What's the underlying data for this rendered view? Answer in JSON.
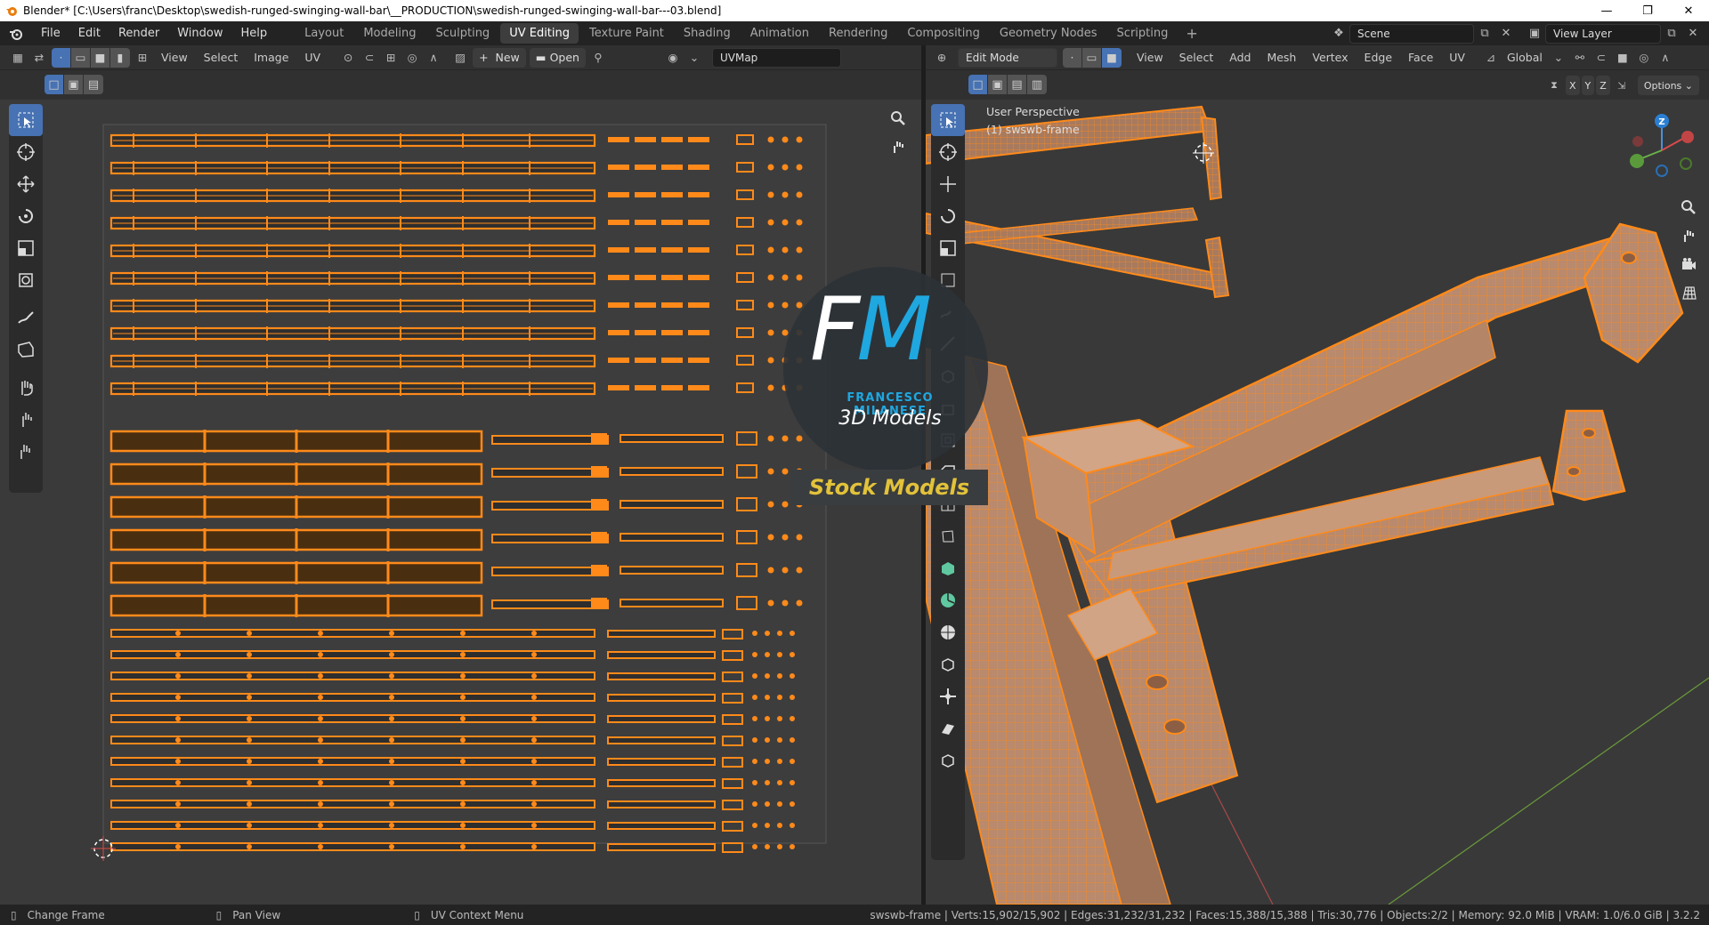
{
  "window": {
    "title": "Blender* [C:\\Users\\franc\\Desktop\\swedish-runged-swinging-wall-bar\\__PRODUCTION\\swedish-runged-swinging-wall-bar---03.blend]",
    "minimize": "—",
    "maximize": "❐",
    "close": "✕"
  },
  "menu": [
    "File",
    "Edit",
    "Render",
    "Window",
    "Help"
  ],
  "workspaces": [
    {
      "label": "Layout",
      "active": false
    },
    {
      "label": "Modeling",
      "active": false
    },
    {
      "label": "Sculpting",
      "active": false
    },
    {
      "label": "UV Editing",
      "active": true
    },
    {
      "label": "Texture Paint",
      "active": false
    },
    {
      "label": "Shading",
      "active": false
    },
    {
      "label": "Animation",
      "active": false
    },
    {
      "label": "Rendering",
      "active": false
    },
    {
      "label": "Compositing",
      "active": false
    },
    {
      "label": "Geometry Nodes",
      "active": false
    },
    {
      "label": "Scripting",
      "active": false
    }
  ],
  "add_workspace": "+",
  "scene": {
    "label": "Scene"
  },
  "view_layer": {
    "label": "View Layer"
  },
  "uv_header": {
    "menus": [
      "View",
      "Select",
      "Image",
      "UV"
    ],
    "new_label": "New",
    "open_label": "Open",
    "uvmap": "UVMap"
  },
  "vp_header": {
    "mode": "Edit Mode",
    "menus": [
      "View",
      "Select",
      "Add",
      "Mesh",
      "Vertex",
      "Edge",
      "Face",
      "UV"
    ],
    "orientation": "Global",
    "options": "Options",
    "axes": [
      "X",
      "Y",
      "Z"
    ]
  },
  "viewport": {
    "perspective": "User Perspective",
    "object": "(1) swswb-frame"
  },
  "gizmo": {
    "z": "Z"
  },
  "watermark": {
    "f": "F",
    "m": "M",
    "name": "FRANCESCO MILANESE",
    "line2": "3D Models",
    "banner": "Stock Models"
  },
  "status": {
    "left": [
      {
        "label": "Change Frame"
      },
      {
        "label": "Pan View"
      },
      {
        "label": "UV Context Menu"
      }
    ],
    "stats": "swswb-frame | Verts:15,902/15,902 | Edges:31,232/31,232 | Faces:15,388/15,388 | Tris:30,776 | Objects:2/2 | Memory: 92.0 MiB | VRAM: 1.0/6.0 GiB | 3.2.2"
  },
  "colors": {
    "accent": "#4772b3",
    "uv_orange": "#ff8a1a",
    "watermark_blue": "#1fa7e0",
    "banner_text": "#e2c23a"
  },
  "icons": {
    "blender": "blender-logo-icon",
    "select": "select-box-icon",
    "cursor": "cursor-icon",
    "move": "move-icon",
    "rotate": "rotate-icon",
    "scale": "scale-icon",
    "transform": "transform-icon",
    "annotate": "annotate-icon",
    "measure": "measure-icon",
    "grab": "grab-icon",
    "zoom": "zoom-icon",
    "hand": "hand-icon",
    "camera": "camera-icon",
    "grid": "grid-icon"
  }
}
